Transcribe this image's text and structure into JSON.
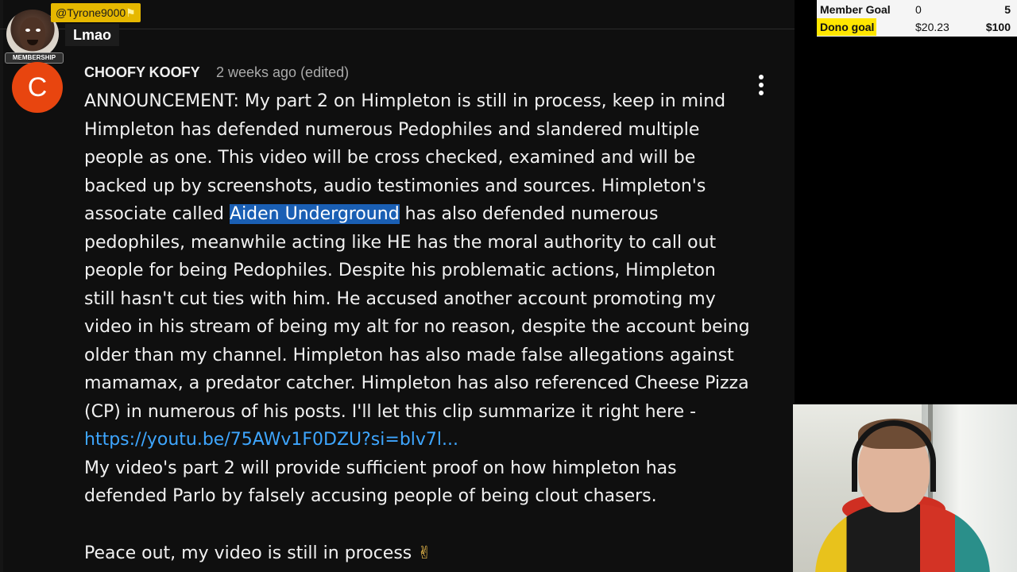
{
  "chat": {
    "username": "@Tyrone9000",
    "badge": "MEMBERSHIP",
    "message": "Lmao"
  },
  "comment": {
    "avatar_letter": "C",
    "avatar_color": "#e8450f",
    "author": "CHOOFY KOOFY",
    "time": "2 weeks ago (edited)",
    "body_part1": "ANNOUNCEMENT: My part 2 on Himpleton is still in process, keep in mind Himpleton has defended numerous Pedophiles and slandered multiple people as one. This video will be cross checked, examined and will be backed up by screenshots, audio testimonies and sources. Himpleton's associate called ",
    "highlighted_text": "Aiden Underground",
    "body_part2": " has also defended numerous pedophiles, meanwhile acting like HE has the moral authority to call out people for being Pedophiles. Despite his problematic actions, Himpleton still hasn't cut ties with him. He accused another account promoting my video in his stream of being my alt for no reason, despite the account being older than my channel. Himpleton has also made false allegations against mamamax, a predator catcher. Himpleton has also referenced Cheese Pizza (CP) in numerous of his posts. I'll let this clip summarize it right here - ",
    "link": "https://youtu.be/75AWv1F0DZU?si=blv7l...",
    "body_part3": "\nMy video's part 2 will provide sufficient proof on how himpleton has defended Parlo by falsely accusing people of being clout chasers.",
    "sign_off": "Peace out, my video is still in process ",
    "sign_off_emoji": "✌"
  },
  "goals": {
    "member": {
      "label": "Member Goal",
      "current": "0",
      "target": "5"
    },
    "dono": {
      "label": "Dono goal",
      "current": "$20.23",
      "target": "$100",
      "progress": 0.2023
    }
  },
  "colors": {
    "highlight": "#1a5fb4",
    "link": "#3ea6ff",
    "goal_bar": "#ffe600",
    "chat_name_bg": "#e6b800"
  }
}
